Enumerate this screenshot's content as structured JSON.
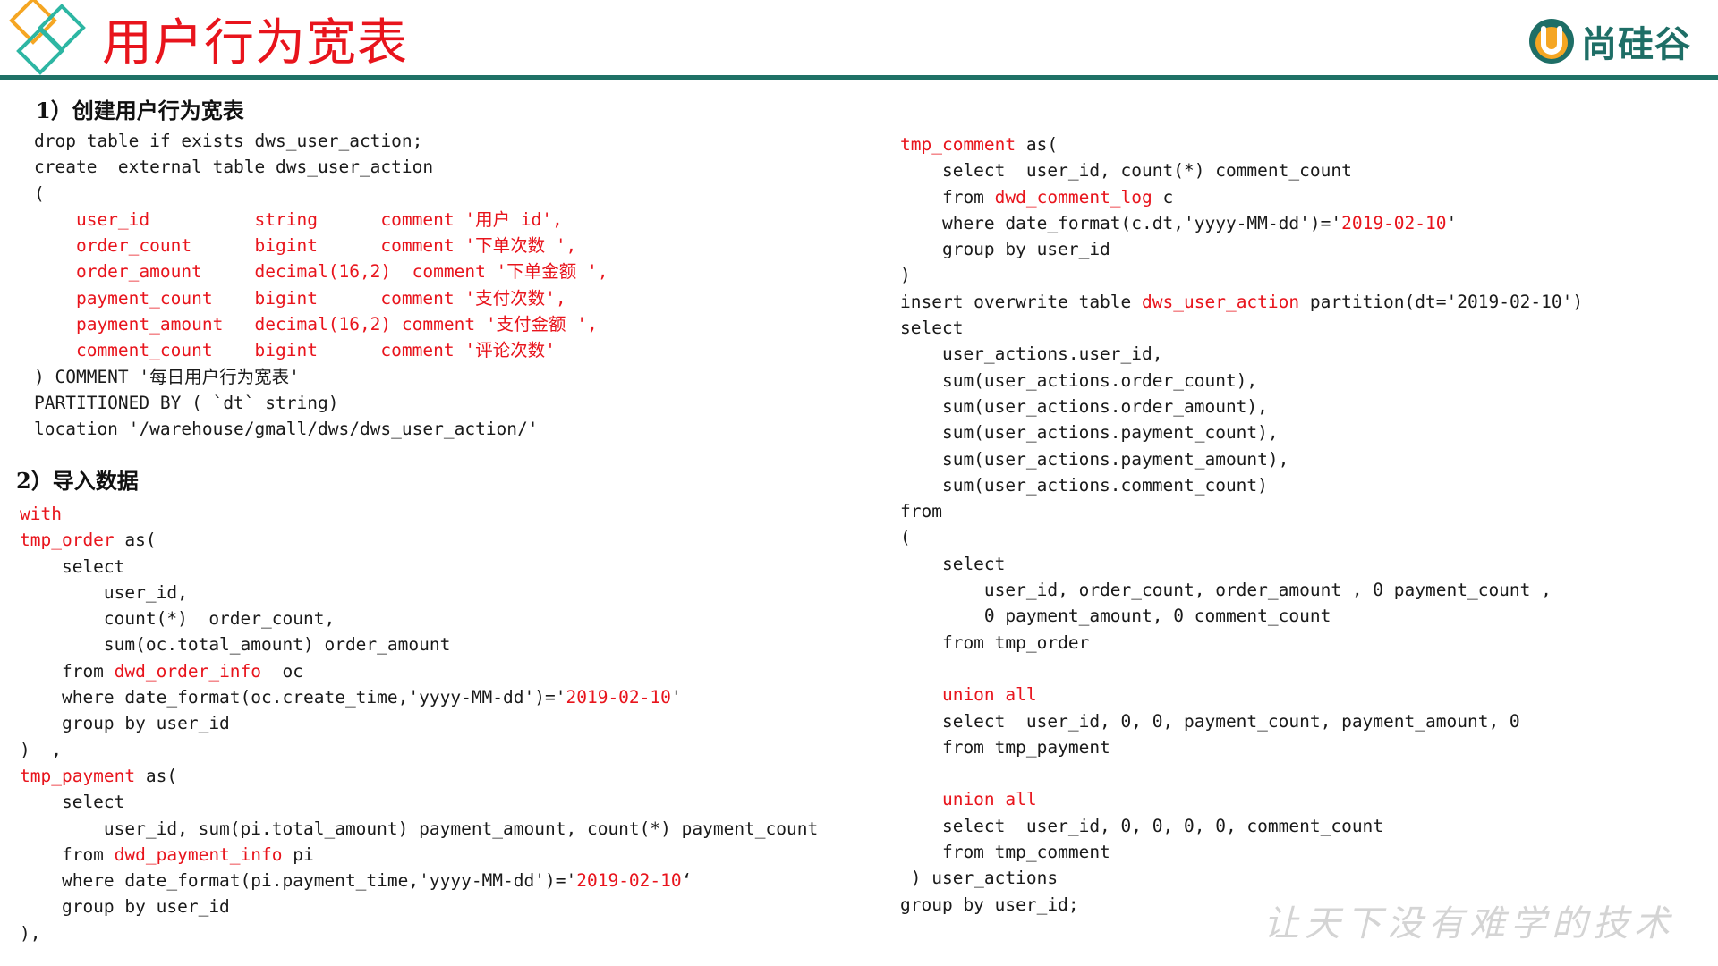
{
  "header": {
    "title": "用户行为宽表",
    "brand_name": "尚硅谷",
    "accent_color": "#e8141c",
    "rule_color": "#1f7166",
    "diamond_colors": [
      "#f5a623",
      "#2db6a3"
    ]
  },
  "sections": {
    "create_heading": "1）创建用户行为宽表",
    "import_heading": "2）导入数据"
  },
  "code_create": [
    [
      [
        "drop table if exists dws_user_action;",
        0
      ]
    ],
    [
      [
        "create  external table dws_user_action",
        0
      ]
    ],
    [
      [
        "(",
        0
      ]
    ],
    [
      [
        "    user_id          string      comment '用户 id',",
        1
      ]
    ],
    [
      [
        "    order_count      bigint      comment '下单次数 ',",
        1
      ]
    ],
    [
      [
        "    order_amount     decimal(16,2)  comment '下单金额 ',",
        1
      ]
    ],
    [
      [
        "    payment_count    bigint      comment '支付次数',",
        1
      ]
    ],
    [
      [
        "    payment_amount   decimal(16,2) comment '支付金额 ',",
        1
      ]
    ],
    [
      [
        "    comment_count    bigint      comment '评论次数'",
        1
      ]
    ],
    [
      [
        ") COMMENT '每日用户行为宽表'",
        0
      ]
    ],
    [
      [
        "PARTITIONED BY ( `dt` string)",
        0
      ]
    ],
    [
      [
        "location '/warehouse/gmall/dws/dws_user_action/'",
        0
      ]
    ]
  ],
  "code_import_left": [
    [
      [
        "with",
        1
      ]
    ],
    [
      [
        "tmp_order",
        1
      ],
      [
        " as(",
        0
      ]
    ],
    [
      [
        "    select",
        0
      ]
    ],
    [
      [
        "        user_id,",
        0
      ]
    ],
    [
      [
        "        count(*)  order_count,",
        0
      ]
    ],
    [
      [
        "        sum(oc.total_amount) order_amount",
        0
      ]
    ],
    [
      [
        "    from ",
        0
      ],
      [
        "dwd_order_info",
        1
      ],
      [
        "  oc",
        0
      ]
    ],
    [
      [
        "    where date_format(oc.create_time,'yyyy-MM-dd')='",
        0
      ],
      [
        "2019-02-10",
        1
      ],
      [
        "'",
        0
      ]
    ],
    [
      [
        "    group by user_id",
        0
      ]
    ],
    [
      [
        ")  ,",
        0
      ]
    ],
    [
      [
        "tmp_payment",
        1
      ],
      [
        " as(",
        0
      ]
    ],
    [
      [
        "    select",
        0
      ]
    ],
    [
      [
        "        user_id, sum(pi.total_amount) payment_amount, count(*) payment_count",
        0
      ]
    ],
    [
      [
        "    from ",
        0
      ],
      [
        "dwd_payment_info",
        1
      ],
      [
        " pi",
        0
      ]
    ],
    [
      [
        "    where date_format(pi.payment_time,'yyyy-MM-dd')='",
        0
      ],
      [
        "2019-02-10",
        1
      ],
      [
        "‘",
        0
      ]
    ],
    [
      [
        "    group by user_id",
        0
      ]
    ],
    [
      [
        "),",
        0
      ]
    ]
  ],
  "code_import_right": [
    [
      [
        "tmp_comment",
        1
      ],
      [
        " as(",
        0
      ]
    ],
    [
      [
        "    select  user_id, count(*) comment_count",
        0
      ]
    ],
    [
      [
        "    from ",
        0
      ],
      [
        "dwd_comment_log",
        1
      ],
      [
        " c",
        0
      ]
    ],
    [
      [
        "    where date_format(c.dt,'yyyy-MM-dd')='",
        0
      ],
      [
        "2019-02-10",
        1
      ],
      [
        "'",
        0
      ]
    ],
    [
      [
        "    group by user_id",
        0
      ]
    ],
    [
      [
        ")",
        0
      ]
    ],
    [
      [
        "insert overwrite table ",
        0
      ],
      [
        "dws_user_action",
        1
      ],
      [
        " partition(dt='2019-02-10')",
        0
      ]
    ],
    [
      [
        "select",
        0
      ]
    ],
    [
      [
        "    user_actions.user_id,",
        0
      ]
    ],
    [
      [
        "    sum(user_actions.order_count),",
        0
      ]
    ],
    [
      [
        "    sum(user_actions.order_amount),",
        0
      ]
    ],
    [
      [
        "    sum(user_actions.payment_count),",
        0
      ]
    ],
    [
      [
        "    sum(user_actions.payment_amount),",
        0
      ]
    ],
    [
      [
        "    sum(user_actions.comment_count)",
        0
      ]
    ],
    [
      [
        "from",
        0
      ]
    ],
    [
      [
        "(",
        0
      ]
    ],
    [
      [
        "    select",
        0
      ]
    ],
    [
      [
        "        user_id, order_count, order_amount , 0 payment_count ,",
        0
      ]
    ],
    [
      [
        "        0 payment_amount, 0 comment_count",
        0
      ]
    ],
    [
      [
        "    from tmp_order",
        0
      ]
    ],
    [
      [
        "",
        0
      ]
    ],
    [
      [
        "    union all",
        1
      ]
    ],
    [
      [
        "    select  user_id, 0, 0, payment_count, payment_amount, 0",
        0
      ]
    ],
    [
      [
        "    from tmp_payment",
        0
      ]
    ],
    [
      [
        "",
        0
      ]
    ],
    [
      [
        "    union all",
        1
      ]
    ],
    [
      [
        "    select  user_id, 0, 0, 0, 0, comment_count",
        0
      ]
    ],
    [
      [
        "    from tmp_comment",
        0
      ]
    ],
    [
      [
        " ) user_actions",
        0
      ]
    ],
    [
      [
        "group by user_id;",
        0
      ]
    ]
  ],
  "footer": {
    "slogan": "让天下没有难学的技术"
  }
}
